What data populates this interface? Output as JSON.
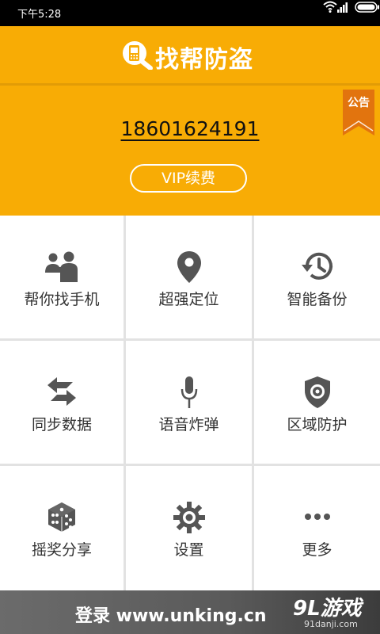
{
  "status_bar": {
    "time": "下午5:28"
  },
  "header": {
    "title": "找帮防盗"
  },
  "account": {
    "phone": "18601624191",
    "vip_button": "VIP续费",
    "notice": "公告"
  },
  "grid": {
    "items": [
      {
        "label": "帮你找手机",
        "icon": "find-phone-icon"
      },
      {
        "label": "超强定位",
        "icon": "location-pin-icon"
      },
      {
        "label": "智能备份",
        "icon": "backup-history-icon"
      },
      {
        "label": "同步数据",
        "icon": "sync-arrows-icon"
      },
      {
        "label": "语音炸弹",
        "icon": "microphone-icon"
      },
      {
        "label": "区域防护",
        "icon": "shield-icon"
      },
      {
        "label": "摇奖分享",
        "icon": "dice-icon"
      },
      {
        "label": "设置",
        "icon": "gear-icon"
      },
      {
        "label": "更多",
        "icon": "more-dots-icon"
      }
    ]
  },
  "footer": {
    "login_text": "登录 www.unking.cn",
    "watermark": "9L游戏",
    "watermark_domain": "91danji.com"
  },
  "colors": {
    "accent": "#f8ac05",
    "icon": "#555555"
  }
}
